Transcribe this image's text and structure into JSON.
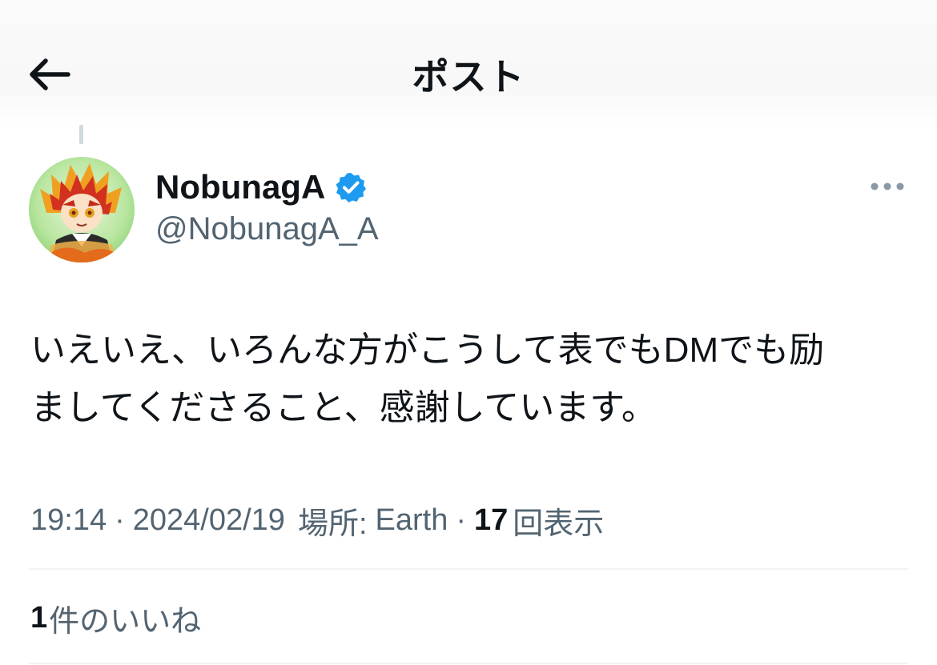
{
  "header": {
    "title": "ポスト",
    "back_icon": "arrow-left-icon"
  },
  "author": {
    "display_name": "NobunagA",
    "handle": "@NobunagA_A",
    "verified": true,
    "verified_color": "#1d9bf0",
    "avatar_icon": "anime-character-avatar"
  },
  "more_icon": "more-dots-icon",
  "tweet": {
    "text": "いえいえ、いろんな方がこうして表でもDMでも励\nましてくださること、感謝しています。"
  },
  "meta": {
    "time": "19:14",
    "dot1": "·",
    "date": "2024/02/19",
    "location_label": "場所:",
    "location": "Earth",
    "dot2": "·",
    "views_count": "17",
    "views_label": "回表示"
  },
  "engagement": {
    "likes_count": "1",
    "likes_label": "件のいいね"
  },
  "colors": {
    "text_primary": "#0f1419",
    "text_secondary": "#536471",
    "divider": "#eff3f4",
    "accent": "#1d9bf0"
  }
}
